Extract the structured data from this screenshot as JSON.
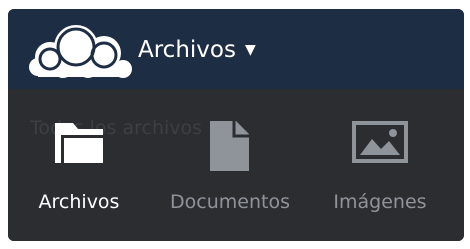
{
  "header": {
    "app_title": "Archivos",
    "caret": "▼",
    "logo_icon": "owncloud-cloud-icon",
    "background": "#1d2d44"
  },
  "menu": {
    "ghost_text": "Todos los archivos",
    "items": [
      {
        "label": "Archivos",
        "icon": "folder-icon",
        "active": true
      },
      {
        "label": "Documentos",
        "icon": "document-icon",
        "active": false
      },
      {
        "label": "Imágenes",
        "icon": "image-icon",
        "active": false
      }
    ],
    "background": "#2b2d31"
  }
}
